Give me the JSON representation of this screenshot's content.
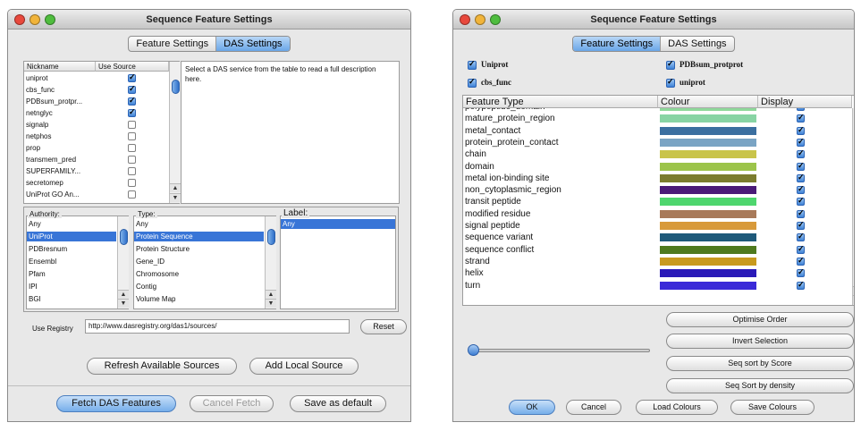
{
  "left_window": {
    "title": "Sequence Feature Settings",
    "tabs": [
      {
        "label": "Feature Settings",
        "selected": false
      },
      {
        "label": "DAS Settings",
        "selected": true
      }
    ],
    "source_table": {
      "headers": [
        "Nickname",
        "Use Source"
      ],
      "rows": [
        {
          "name": "uniprot",
          "checked": true
        },
        {
          "name": "cbs_func",
          "checked": true
        },
        {
          "name": "PDBsum_protpr...",
          "checked": true
        },
        {
          "name": "netnglyc",
          "checked": true
        },
        {
          "name": "signalp",
          "checked": false
        },
        {
          "name": "netphos",
          "checked": false
        },
        {
          "name": "prop",
          "checked": false
        },
        {
          "name": "transmem_pred",
          "checked": false
        },
        {
          "name": "SUPERFAMILY...",
          "checked": false
        },
        {
          "name": "secretomep",
          "checked": false
        },
        {
          "name": "UniProt GO An...",
          "checked": false
        }
      ]
    },
    "description": "Select a DAS service from the table to read a full description here.",
    "authority": {
      "label": "Authority:",
      "items": [
        "Any",
        "UniProt",
        "PDBresnum",
        "Ensembl",
        "Pfam",
        "IPI",
        "BGI"
      ],
      "selected": "UniProt"
    },
    "type": {
      "label": "Type:",
      "items": [
        "Any",
        "Protein Sequence",
        "Protein Structure",
        "Gene_ID",
        "Chromosome",
        "Contig",
        "Volume Map"
      ],
      "selected": "Protein Sequence"
    },
    "label_list": {
      "label": "Label:",
      "items": [
        "Any"
      ],
      "selected": "Any"
    },
    "registry": {
      "label": "Use Registry",
      "value": "http://www.dasregistry.org/das1/sources/",
      "reset": "Reset"
    },
    "buttons": {
      "refresh": "Refresh Available Sources",
      "add_local": "Add Local Source",
      "fetch": "Fetch DAS Features",
      "cancel": "Cancel Fetch",
      "save_default": "Save as default"
    }
  },
  "right_window": {
    "title": "Sequence Feature Settings",
    "tabs": [
      {
        "label": "Feature Settings",
        "selected": true
      },
      {
        "label": "DAS Settings",
        "selected": false
      }
    ],
    "sources": [
      {
        "name": "Uniprot",
        "checked": true
      },
      {
        "name": "cbs_func",
        "checked": true
      },
      {
        "name": "PDBsum_protprot",
        "checked": true
      },
      {
        "name": "uniprot",
        "checked": true
      }
    ],
    "feature_table": {
      "headers": [
        "Feature Type",
        "Colour",
        "Display"
      ],
      "rows": [
        {
          "type": "polypeptide_domain",
          "color": "#8fd89a",
          "display": true
        },
        {
          "type": "mature_protein_region",
          "color": "#88d4a4",
          "display": true
        },
        {
          "type": "metal_contact",
          "color": "#3b6fa0",
          "display": true
        },
        {
          "type": "protein_protein_contact",
          "color": "#7aa4c4",
          "display": true
        },
        {
          "type": "chain",
          "color": "#c9c44a",
          "display": true
        },
        {
          "type": "domain",
          "color": "#9cc44a",
          "display": true
        },
        {
          "type": "metal ion-binding site",
          "color": "#7b7c2e",
          "display": true
        },
        {
          "type": "non_cytoplasmic_region",
          "color": "#4a1a78",
          "display": true
        },
        {
          "type": "transit peptide",
          "color": "#4ed66e",
          "display": true
        },
        {
          "type": "modified residue",
          "color": "#a87a5a",
          "display": true
        },
        {
          "type": "signal peptide",
          "color": "#d89a3a",
          "display": true
        },
        {
          "type": "sequence variant",
          "color": "#1f5a7a",
          "display": true
        },
        {
          "type": "sequence conflict",
          "color": "#4f7a1e",
          "display": true
        },
        {
          "type": "strand",
          "color": "#c89a1e",
          "display": true
        },
        {
          "type": "helix",
          "color": "#2a1ab8",
          "display": true
        },
        {
          "type": "turn",
          "color": "#3a2ad8",
          "display": true
        }
      ]
    },
    "side_buttons": {
      "optimise": "Optimise Order",
      "invert": "Invert Selection",
      "sort_score": "Seq sort by Score",
      "sort_density": "Seq Sort by density"
    },
    "bottom_buttons": {
      "ok": "OK",
      "cancel": "Cancel",
      "load": "Load Colours",
      "save": "Save Colours"
    }
  },
  "colors": {
    "close": "#e8483c",
    "minimize": "#f1b43a",
    "zoom": "#4fbd3e",
    "selection": "#3875d7"
  }
}
